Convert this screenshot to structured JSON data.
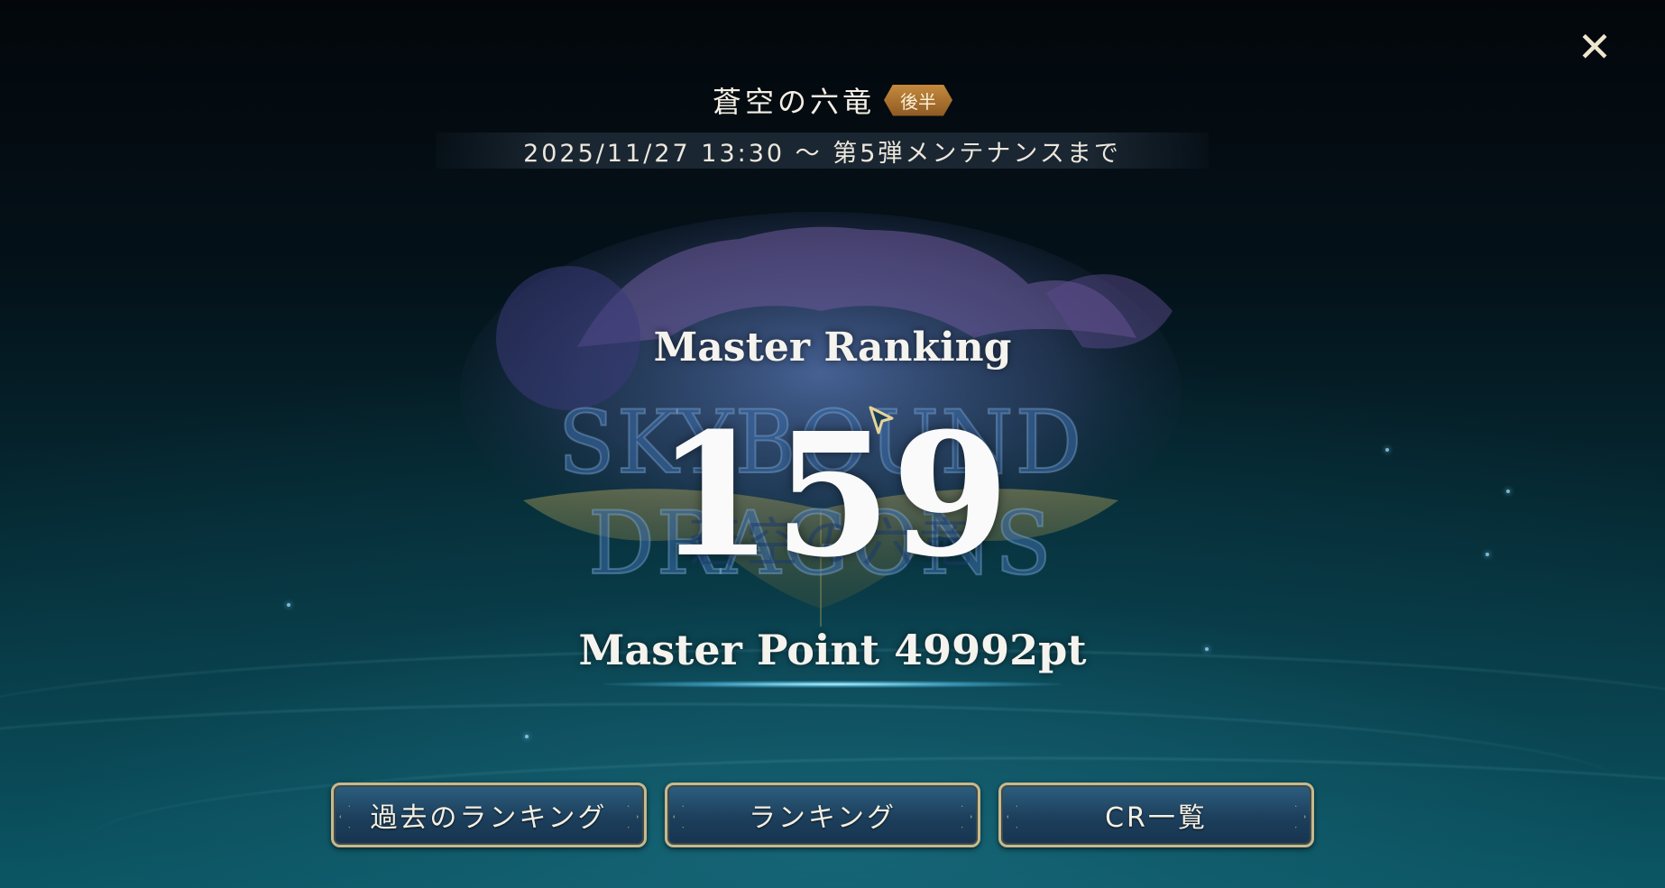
{
  "header": {
    "event_title": "蒼空の六竜",
    "phase_badge": "後半",
    "period": "2025/11/27 13:30 〜 第5弾メンテナンスまで"
  },
  "close_icon": "close-icon",
  "logo": {
    "title_text": "SKYBOUND DRAGONS",
    "subtitle_text": "蒼空の六竜"
  },
  "ranking": {
    "label": "Master Ranking",
    "value": "159",
    "point_text": "Master Point 49992pt"
  },
  "buttons": {
    "past_ranking": "過去のランキング",
    "ranking": "ランキング",
    "cr_list": "CR一覧"
  },
  "colors": {
    "button_border": "#c7b98d",
    "button_fill": "#1c3f5c",
    "badge": "#b07634",
    "background_bottom": "#0b5866"
  }
}
